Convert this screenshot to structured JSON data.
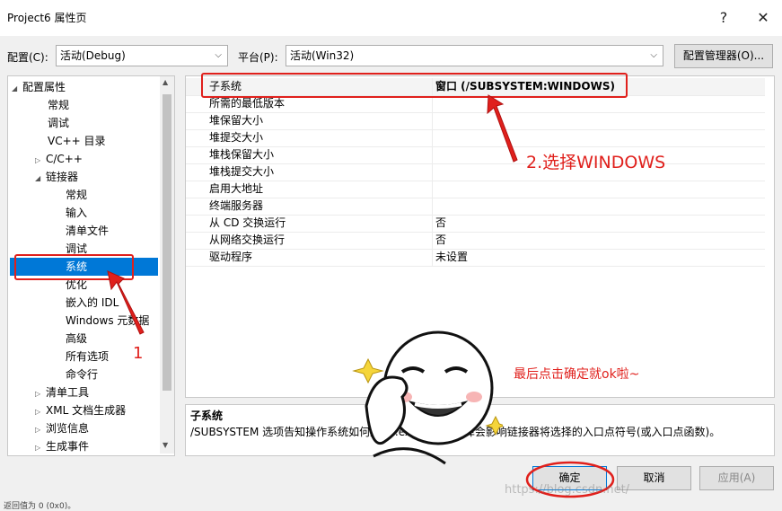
{
  "window": {
    "title": "Project6 属性页",
    "help": "?",
    "close": "✕"
  },
  "toolbar": {
    "config_label": "配置(C):",
    "config_value": "活动(Debug)",
    "platform_label": "平台(P):",
    "platform_value": "活动(Win32)",
    "manager_button": "配置管理器(O)..."
  },
  "tree": {
    "items": [
      {
        "label": "配置属性"
      },
      {
        "label": "常规"
      },
      {
        "label": "调试"
      },
      {
        "label": "VC++ 目录"
      },
      {
        "label": "C/C++"
      },
      {
        "label": "链接器"
      },
      {
        "label": "常规"
      },
      {
        "label": "输入"
      },
      {
        "label": "清单文件"
      },
      {
        "label": "调试"
      },
      {
        "label": "系统"
      },
      {
        "label": "优化"
      },
      {
        "label": "嵌入的 IDL"
      },
      {
        "label": "Windows 元数据"
      },
      {
        "label": "高级"
      },
      {
        "label": "所有选项"
      },
      {
        "label": "命令行"
      },
      {
        "label": "清单工具"
      },
      {
        "label": "XML 文档生成器"
      },
      {
        "label": "浏览信息"
      },
      {
        "label": "生成事件"
      }
    ]
  },
  "grid": {
    "rows": [
      {
        "name": "子系统",
        "value": "窗口 (/SUBSYSTEM:WINDOWS)"
      },
      {
        "name": "所需的最低版本",
        "value": ""
      },
      {
        "name": "堆保留大小",
        "value": ""
      },
      {
        "name": "堆提交大小",
        "value": ""
      },
      {
        "name": "堆栈保留大小",
        "value": ""
      },
      {
        "name": "堆栈提交大小",
        "value": ""
      },
      {
        "name": "启用大地址",
        "value": ""
      },
      {
        "name": "终端服务器",
        "value": ""
      },
      {
        "name": "从 CD 交换运行",
        "value": "否"
      },
      {
        "name": "从网络交换运行",
        "value": "否"
      },
      {
        "name": "驱动程序",
        "value": "未设置"
      }
    ]
  },
  "description": {
    "title": "子系统",
    "text": "/SUBSYSTEM 选项告知操作系统如何运行 .exe 文件。选择会影响链接器将选择的入口点符号(或入口点函数)。"
  },
  "buttons": {
    "ok": "确定",
    "cancel": "取消",
    "apply": "应用(A)"
  },
  "annotations": {
    "step1": "1",
    "step2": "2.选择WINDOWS",
    "final": "最后点击确定就ok啦~"
  },
  "status_text": "返回值为 0 (0x0)。",
  "watermark": "https://blog.csdn.net/",
  "colors": {
    "selection": "#0078d7",
    "annotation": "#e0201c"
  }
}
